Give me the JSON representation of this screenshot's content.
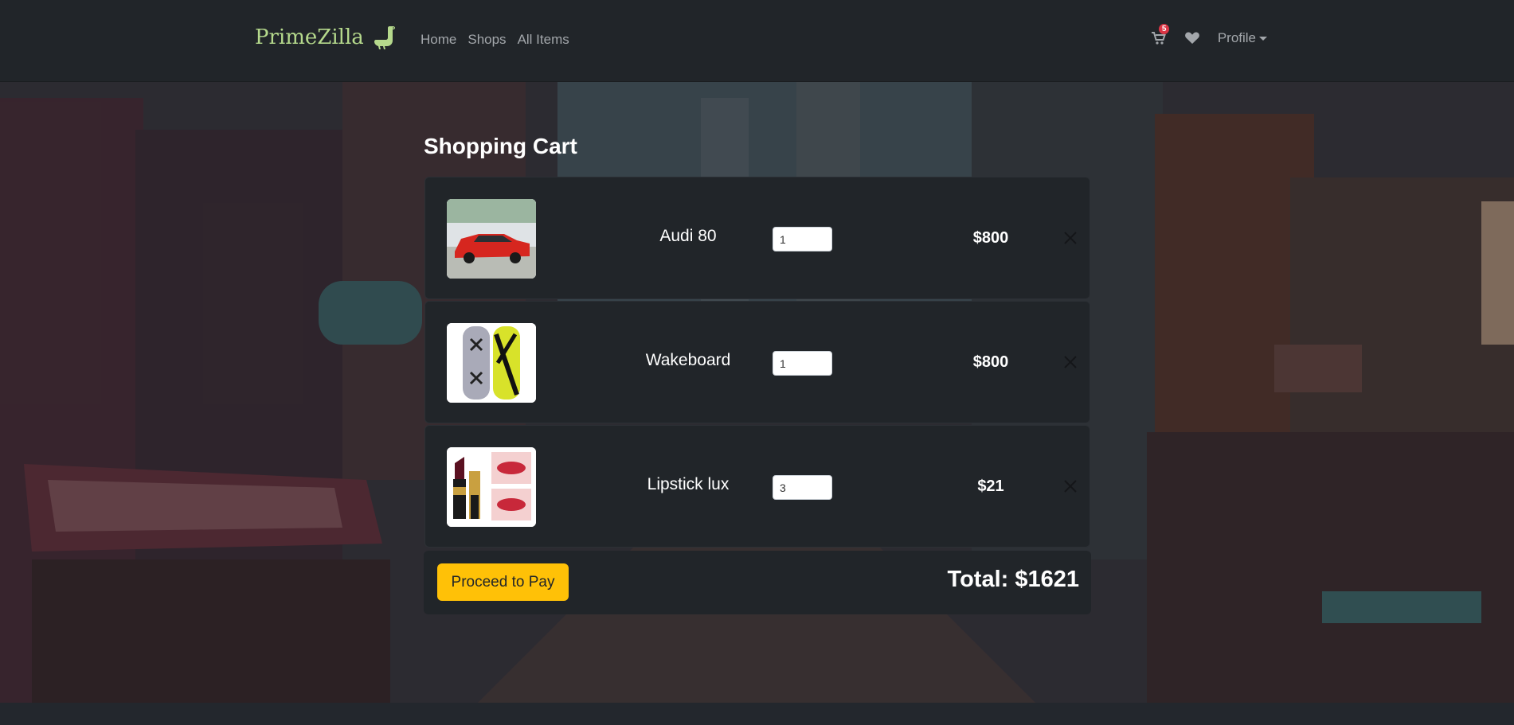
{
  "navbar": {
    "brand": "PrimeZilla",
    "links": [
      "Home",
      "Shops",
      "All Items"
    ],
    "cart_count": "5",
    "profile_label": "Profile"
  },
  "cart": {
    "title": "Shopping Cart",
    "items": [
      {
        "name": "Audi 80",
        "quantity": "1",
        "price": "$800",
        "image": "red-car"
      },
      {
        "name": "Wakeboard",
        "quantity": "1",
        "price": "$800",
        "image": "wakeboard"
      },
      {
        "name": "Lipstick lux",
        "quantity": "3",
        "price": "$21",
        "image": "lipstick"
      }
    ],
    "pay_label": "Proceed to Pay",
    "total": "Total: $1621"
  },
  "colors": {
    "brand": "#b5d98c",
    "accent": "#ffc107",
    "badge": "#dc3545",
    "panel": "#212529"
  }
}
